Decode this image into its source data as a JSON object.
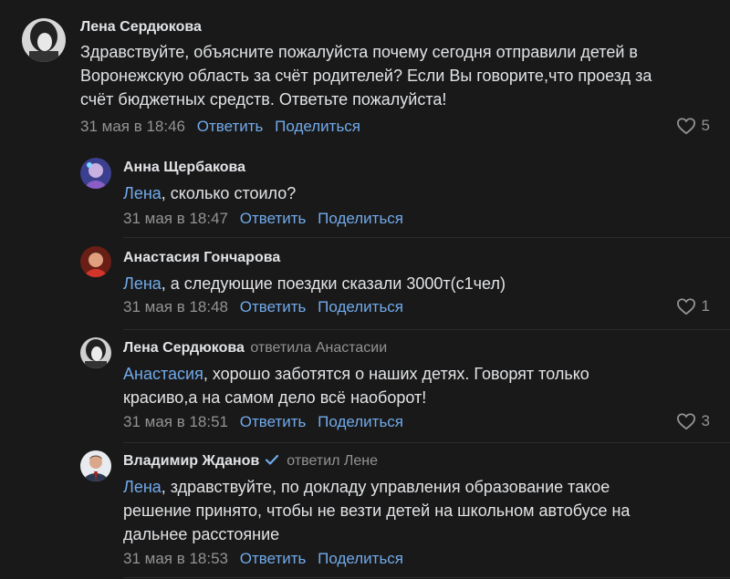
{
  "comments": [
    {
      "author": "Лена Сердюкова",
      "replied_to": "",
      "mention": "",
      "text_lines": [
        "Здравствуйте, объясните пожалуйста почему сегодня отправили детей в",
        "Воронежскую область за счёт родителей? Если Вы говорите,что проезд за",
        "счёт бюджетных средств. Ответьте пожалуйста!"
      ],
      "time": "31 мая в 18:46",
      "reply_label": "Ответить",
      "share_label": "Поделиться",
      "likes": "5"
    },
    {
      "author": "Анна Щербакова",
      "replied_to": "",
      "mention": "Лена",
      "text_lines": [
        ", сколько стоило?"
      ],
      "time": "31 мая в 18:47",
      "reply_label": "Ответить",
      "share_label": "Поделиться",
      "likes": ""
    },
    {
      "author": "Анастасия Гончарова",
      "replied_to": "",
      "mention": "Лена",
      "text_lines": [
        ", а следующие поездки сказали 3000т(с1чел)"
      ],
      "time": "31 мая в 18:48",
      "reply_label": "Ответить",
      "share_label": "Поделиться",
      "likes": "1"
    },
    {
      "author": "Лена Сердюкова",
      "replied_to": "ответила Анастасии",
      "mention": "Анастасия",
      "text_lines": [
        ", хорошо заботятся о наших детях. Говорят только",
        "красиво,а на самом дело всё наоборот!"
      ],
      "time": "31 мая в 18:51",
      "reply_label": "Ответить",
      "share_label": "Поделиться",
      "likes": "3"
    },
    {
      "author": "Владимир Жданов",
      "replied_to": "ответил Лене",
      "mention": "Лена",
      "text_lines": [
        ", здравствуйте, по докладу управления образование такое",
        "решение принято, чтобы не везти детей на школьном автобусе на",
        "дальнее расстояние"
      ],
      "time": "31 мая в 18:53",
      "reply_label": "Ответить",
      "share_label": "Поделиться",
      "likes": ""
    }
  ],
  "colors": {
    "background": "#191919",
    "text": "#e1e3e6",
    "muted": "#939393",
    "link": "#71aaeb",
    "verified": "#71aaeb"
  },
  "icons": {
    "like": "heart-outline-icon",
    "verified": "verified-check-icon"
  }
}
